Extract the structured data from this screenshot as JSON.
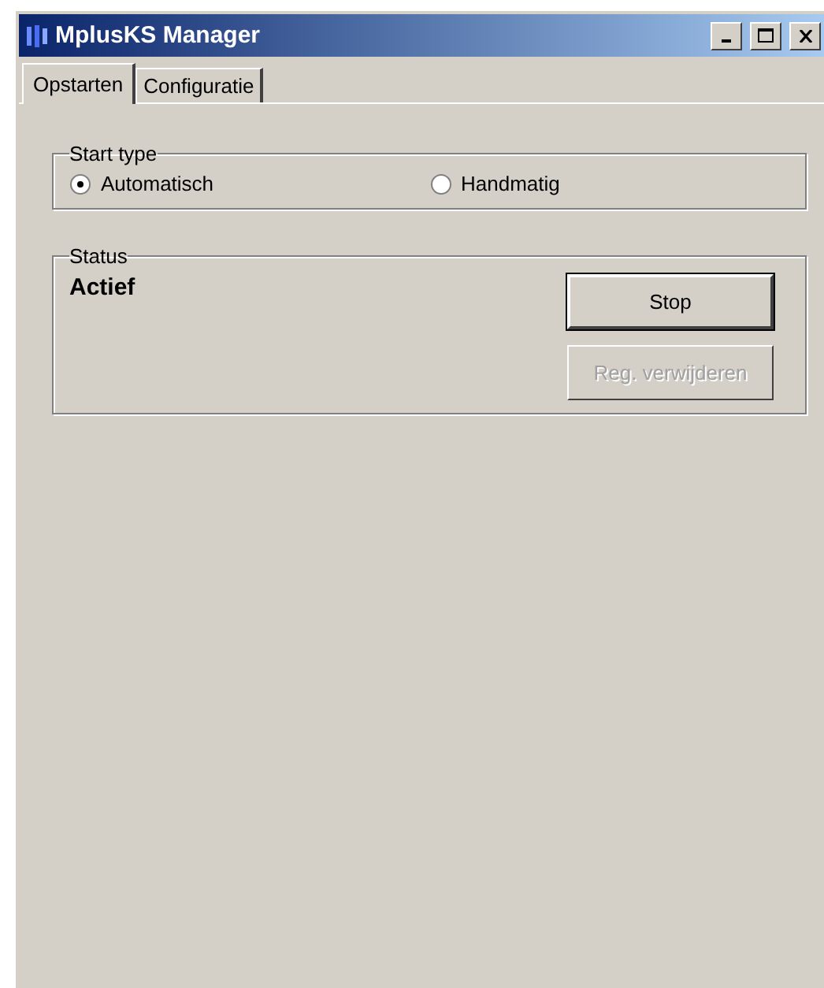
{
  "window": {
    "title": "MplusKS Manager"
  },
  "tabs": [
    {
      "label": "Opstarten",
      "selected": true
    },
    {
      "label": "Configuratie",
      "selected": false
    }
  ],
  "start_type": {
    "title": "Start type",
    "options": [
      {
        "label": "Automatisch",
        "selected": true
      },
      {
        "label": "Handmatig",
        "selected": false
      }
    ]
  },
  "status": {
    "title": "Status",
    "value": "Actief",
    "buttons": [
      {
        "label": "Stop",
        "disabled": false,
        "default": true
      },
      {
        "label": "Reg. verwijderen",
        "disabled": true,
        "default": false
      }
    ]
  }
}
